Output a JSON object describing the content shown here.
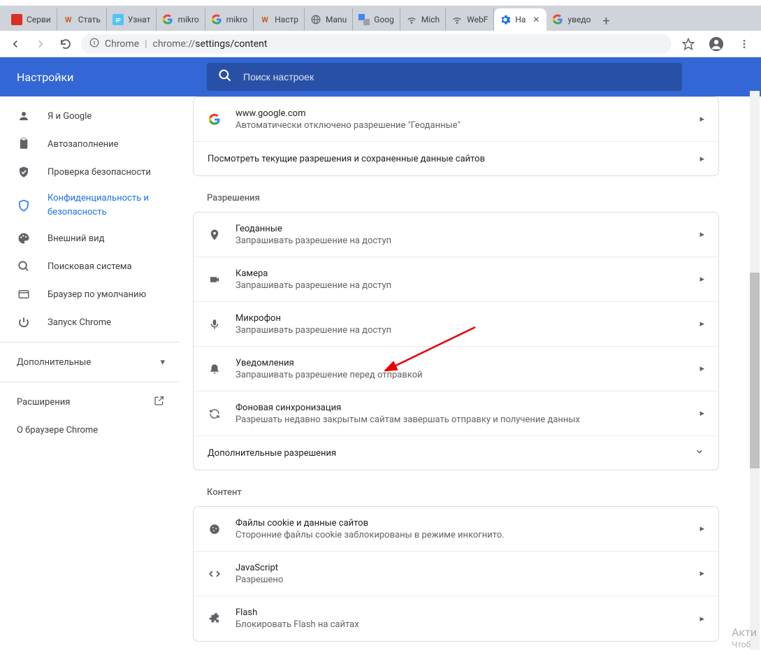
{
  "window": {
    "tabs": [
      {
        "title": "Серви",
        "favicon_color": "#d93025"
      },
      {
        "title": "Стать",
        "favicon_letter": "W"
      },
      {
        "title": "Узнат",
        "favicon_bg": "#1a73e8",
        "favicon_text": "IP"
      },
      {
        "title": "mikro",
        "favicon_letter": "G"
      },
      {
        "title": "mikro",
        "favicon_letter": "G"
      },
      {
        "title": "Настр",
        "favicon_letter": "W"
      },
      {
        "title": "Manu",
        "favicon_globe": true
      },
      {
        "title": "Goog",
        "favicon_translate": true
      },
      {
        "title": "Mich",
        "favicon_wifi": true
      },
      {
        "title": "WebF",
        "favicon_wifi": true
      },
      {
        "title": "На",
        "favicon_gear": true,
        "active": true
      },
      {
        "title": "уведо",
        "favicon_letter": "G"
      }
    ]
  },
  "addressbar": {
    "prefix": "Chrome",
    "url_scheme": "chrome://",
    "url_path": "settings/content"
  },
  "header": {
    "title": "Настройки",
    "search_placeholder": "Поиск настроек"
  },
  "sidebar": {
    "items": [
      {
        "label": "Я и Google"
      },
      {
        "label": "Автозаполнение"
      },
      {
        "label": "Проверка безопасности"
      },
      {
        "label": "Конфиденциальность и безопасность",
        "active": true
      },
      {
        "label": "Внешний вид"
      },
      {
        "label": "Поисковая система"
      },
      {
        "label": "Браузер по умолчанию"
      },
      {
        "label": "Запуск Chrome"
      }
    ],
    "advanced": "Дополнительные",
    "extensions": "Расширения",
    "about": "О браузере Chrome"
  },
  "recent": {
    "site": "www.google.com",
    "site_sub": "Автоматически отключено разрешение \"Геоданные\"",
    "view_all": "Посмотреть текущие разрешения и сохраненные данные сайтов"
  },
  "permissions_title": "Разрешения",
  "permissions": [
    {
      "title": "Геоданные",
      "sub": "Запрашивать разрешение на доступ",
      "icon": "location"
    },
    {
      "title": "Камера",
      "sub": "Запрашивать разрешение на доступ",
      "icon": "camera"
    },
    {
      "title": "Микрофон",
      "sub": "Запрашивать разрешение на доступ",
      "icon": "mic"
    },
    {
      "title": "Уведомления",
      "sub": "Запрашивать разрешение перед отправкой",
      "icon": "bell"
    },
    {
      "title": "Фоновая синхронизация",
      "sub": "Разрешать недавно закрытым сайтам завершать отправку и получение данных",
      "icon": "sync"
    }
  ],
  "more_permissions": "Дополнительные разрешения",
  "content_title": "Контент",
  "content": [
    {
      "title": "Файлы cookie и данные сайтов",
      "sub": "Сторонние файлы cookie заблокированы в режиме инкогнито.",
      "icon": "cookie"
    },
    {
      "title": "JavaScript",
      "sub": "Разрешено",
      "icon": "code"
    },
    {
      "title": "Flash",
      "sub": "Блокировать Flash на сайтах",
      "icon": "puzzle"
    }
  ],
  "watermark": {
    "line1": "Акти",
    "line2": "Чтоб"
  }
}
